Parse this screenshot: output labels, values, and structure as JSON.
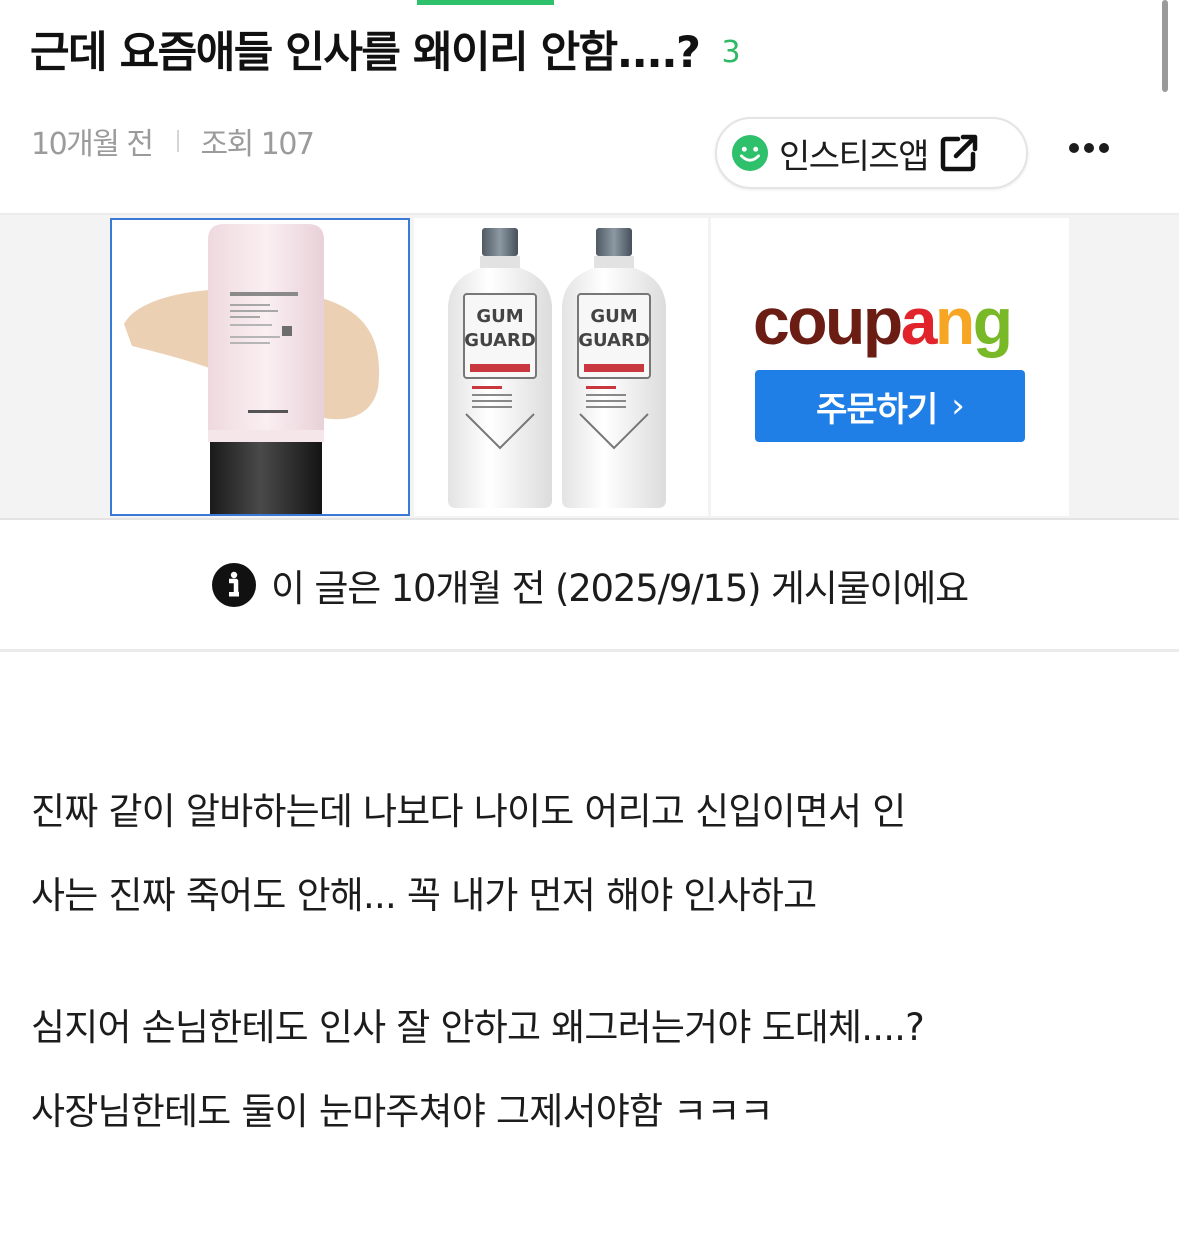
{
  "post": {
    "title": "근데 요즘애들 인사를 왜이리 안함....?",
    "comment_count": "3",
    "time_ago": "10개월 전",
    "views": "조회 107"
  },
  "app_button": {
    "label": "인스티즈앱"
  },
  "ad": {
    "products": [
      {
        "icon": "sunscreen-tube-product"
      },
      {
        "icon": "gum-guard-bottles-product"
      }
    ],
    "brand_logo": "coupang",
    "brand_logo_colors": [
      "#6b1d14",
      "#6b1d14",
      "#6b1d14",
      "#6b1d14",
      "#e1232c",
      "#f6a623",
      "#79b928",
      "#3f9be0"
    ],
    "cta_label": "주문하기",
    "cta_color": "#1f7fe6"
  },
  "notice": {
    "text": "이 글은 10개월 전 (2025/9/15) 게시물이에요"
  },
  "body": {
    "lines": [
      "진짜 같이 알바하는데 나보다 나이도 어리고 신입이면서 인",
      "사는 진짜 죽어도 안해... 꼭 내가 먼저 해야 인사하고",
      "심지어 손님한테도 인사 잘 안하고 왜그러는거야 도대체....?",
      "사장님한테도 둘이 눈마주쳐야 그제서야함 ㅋㅋㅋ"
    ]
  },
  "colors": {
    "accent_green": "#2fc06c",
    "count_green": "#2fb865",
    "meta_gray": "#9b9b9b"
  }
}
